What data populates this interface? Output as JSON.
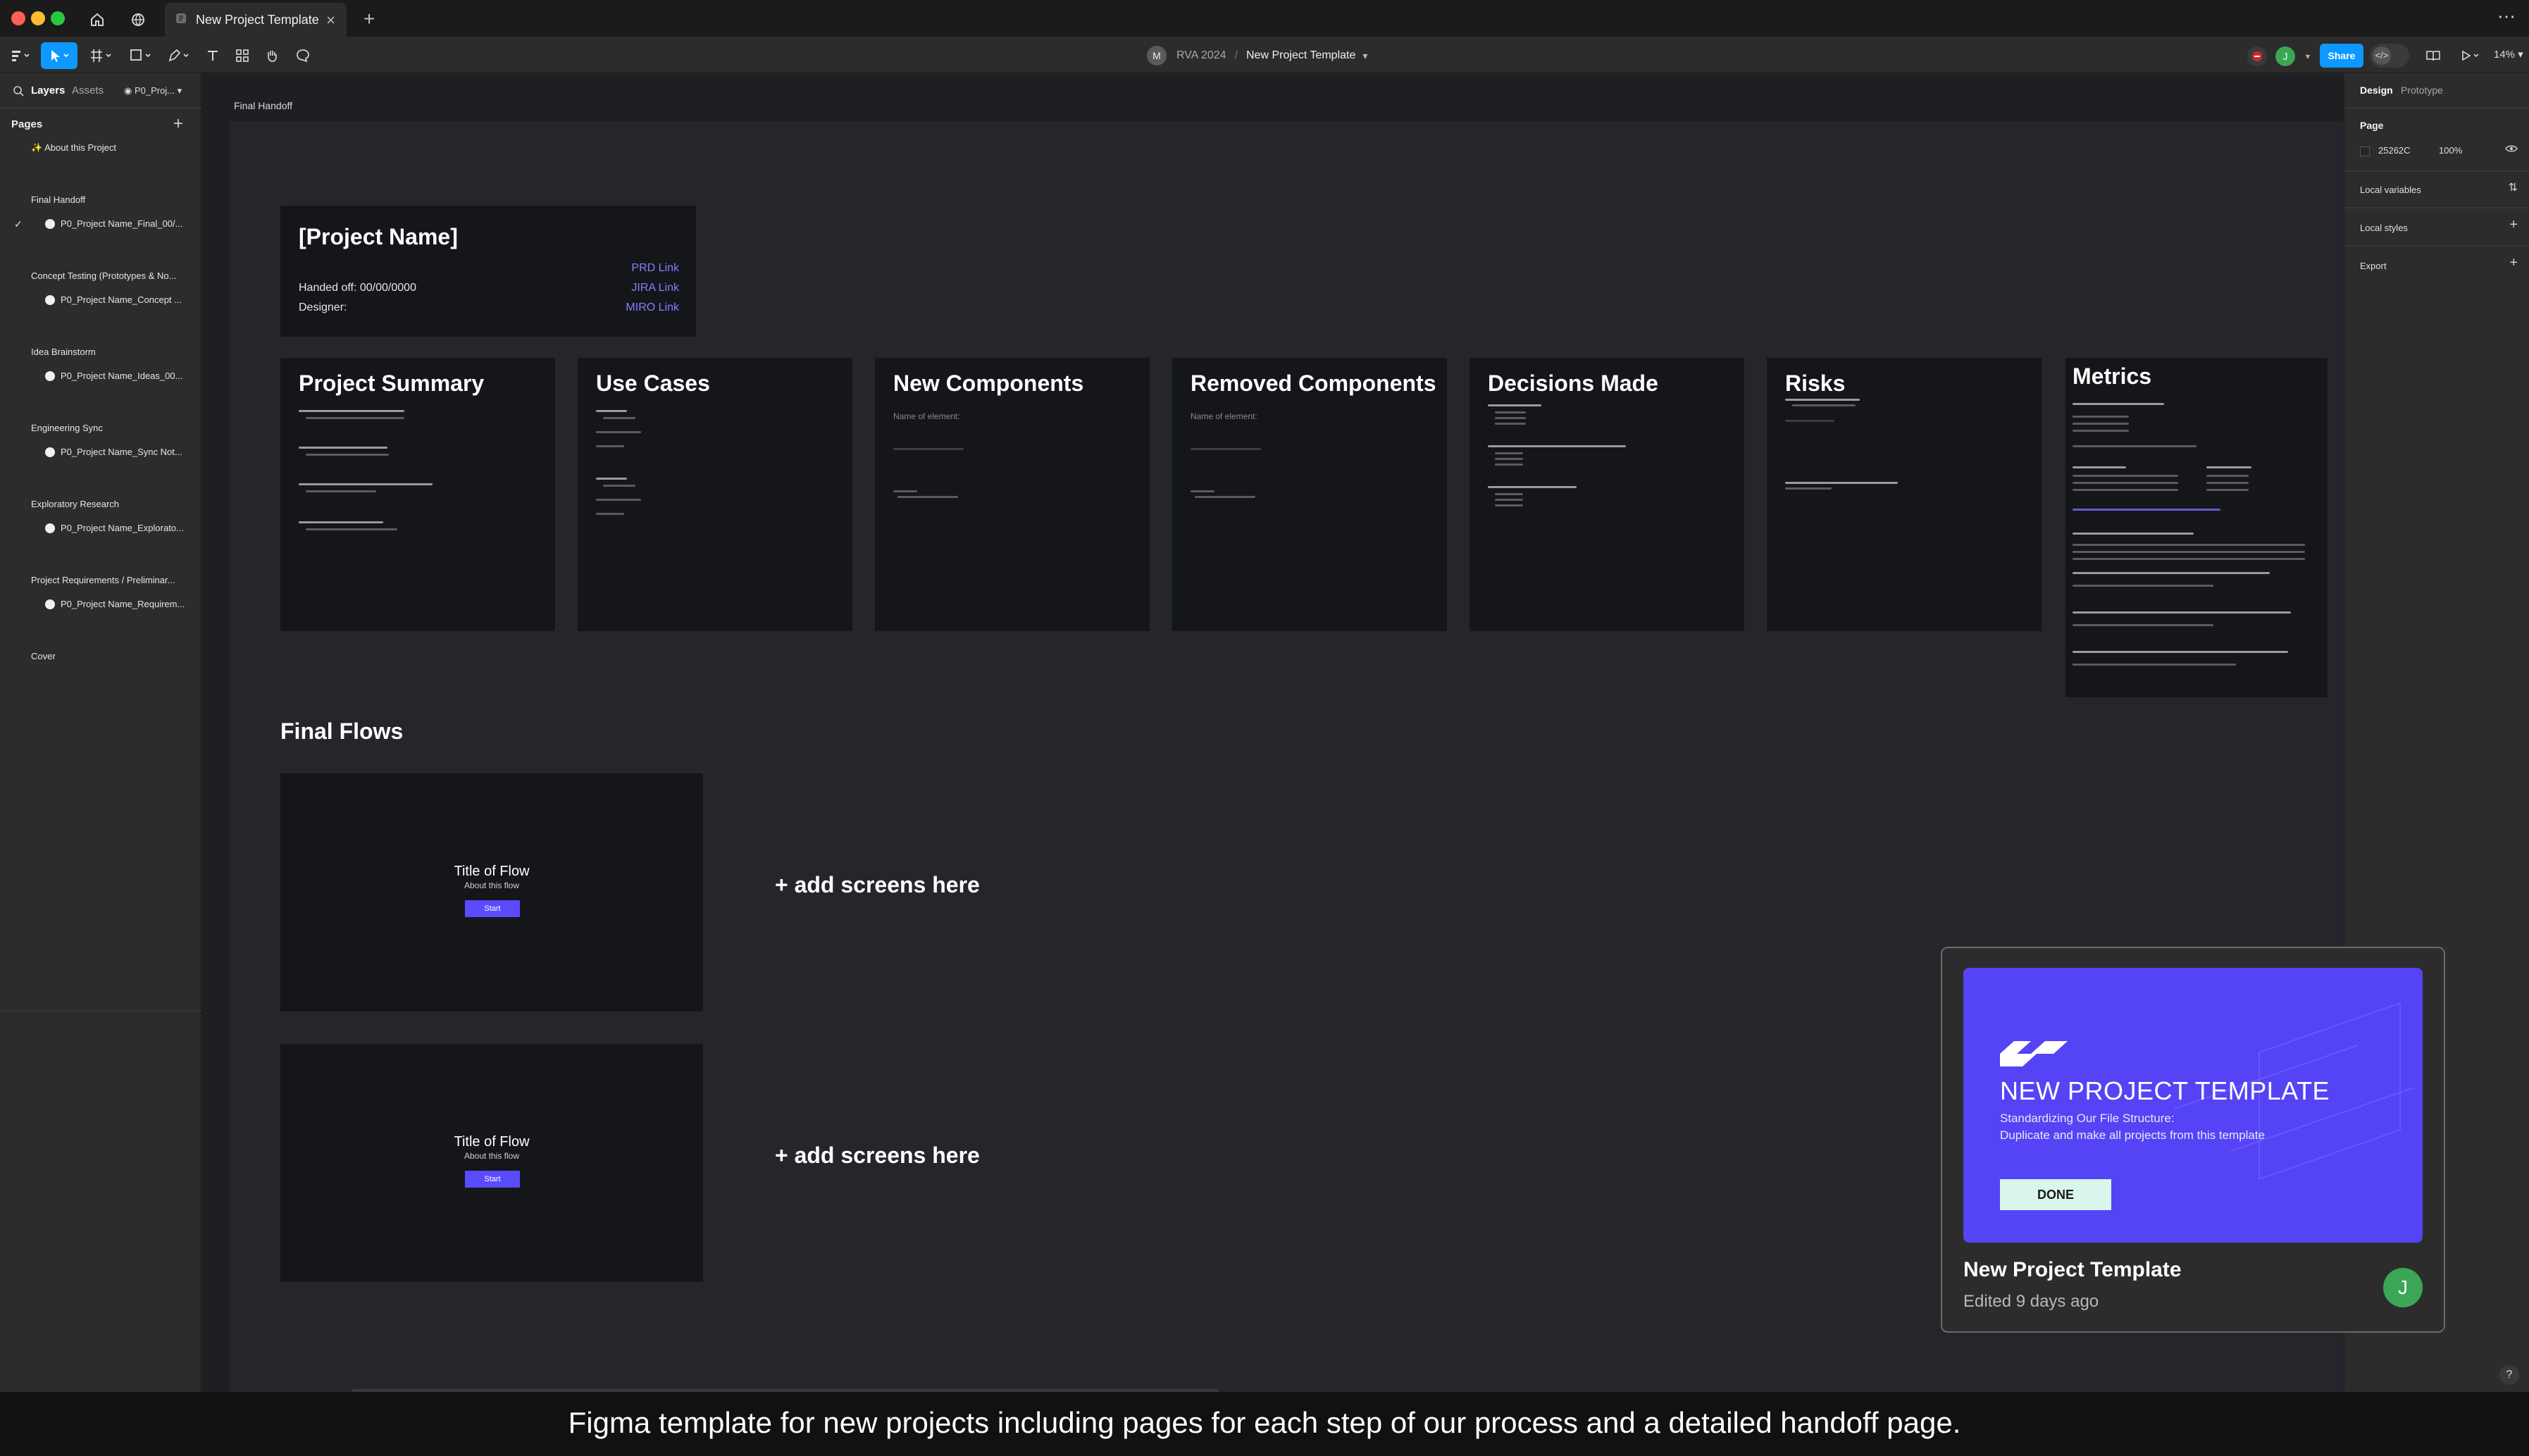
{
  "window": {
    "tab_title": "New Project Template",
    "tab_close": "×",
    "new_tab": "+",
    "more": "⋯"
  },
  "toolbar": {
    "team_initial": "M",
    "team_name": "RVA 2024",
    "separator": "/",
    "file_name": "New Project Template",
    "avatar_initial": "J",
    "share_label": "Share",
    "zoom_level": "14%"
  },
  "left_panel": {
    "tabs": [
      "Layers",
      "Assets"
    ],
    "page_selector": "P0_Proj...",
    "pages_heading": "Pages",
    "pages": [
      {
        "label": "✨ About this Project",
        "indented": false,
        "current": false
      },
      {
        "label": "Final Handoff",
        "indented": false,
        "current": false
      },
      {
        "label": "P0_Project Name_Final_00/...",
        "indented": true,
        "current": true
      },
      {
        "label": "Concept Testing (Prototypes & No...",
        "indented": false,
        "current": false
      },
      {
        "label": "P0_Project Name_Concept ...",
        "indented": true,
        "current": false
      },
      {
        "label": "Idea Brainstorm",
        "indented": false,
        "current": false
      },
      {
        "label": "P0_Project Name_Ideas_00...",
        "indented": true,
        "current": false
      },
      {
        "label": "Engineering Sync",
        "indented": false,
        "current": false
      },
      {
        "label": "P0_Project Name_Sync Not...",
        "indented": true,
        "current": false
      },
      {
        "label": "Exploratory Research",
        "indented": false,
        "current": false
      },
      {
        "label": "P0_Project Name_Explorato...",
        "indented": true,
        "current": false
      },
      {
        "label": "Project Requirements / Preliminar...",
        "indented": false,
        "current": false
      },
      {
        "label": "P0_Project Name_Requirem...",
        "indented": true,
        "current": false
      },
      {
        "label": "Cover",
        "indented": false,
        "current": false
      }
    ]
  },
  "canvas": {
    "frame_label": "Final Handoff",
    "handoff": {
      "title": "[Project Name]",
      "handed_off": "Handed off: 00/00/0000",
      "designer": "Designer:",
      "links": [
        "PRD Link",
        "JIRA Link",
        "MIRO Link"
      ]
    },
    "sections": [
      {
        "title": "Project Summary"
      },
      {
        "title": "Use Cases"
      },
      {
        "title": "New Components",
        "field": "Name of element:"
      },
      {
        "title": "Removed Components",
        "field": "Name of element:"
      },
      {
        "title": "Decisions Made"
      },
      {
        "title": "Risks"
      }
    ],
    "metrics_title": "Metrics",
    "final_flows_title": "Final Flows",
    "flows": [
      {
        "title": "Title of Flow",
        "subtitle": "About this flow",
        "button": "Start",
        "add": "+ add screens here"
      },
      {
        "title": "Title of Flow",
        "subtitle": "About this flow",
        "button": "Start",
        "add": "+ add screens here"
      }
    ]
  },
  "right_panel": {
    "tabs": [
      "Design",
      "Prototype"
    ],
    "page_heading": "Page",
    "bg_hex": "25262C",
    "bg_opacity": "100%",
    "local_variables": "Local variables",
    "local_styles": "Local styles",
    "export": "Export",
    "help": "?"
  },
  "preview_popup": {
    "thumb_title": "NEW PROJECT TEMPLATE",
    "thumb_sub1": "Standardizing Our File Structure:",
    "thumb_sub2": "Duplicate and make all projects from this template",
    "done_label": "DONE",
    "file_name": "New Project Template",
    "edited": "Edited 9 days ago",
    "avatar_initial": "J"
  },
  "caption": "Figma template for new projects including pages for each step of our process and a detailed handoff page.",
  "colors": {
    "accent_blue": "#0d99ff",
    "brand_purple": "#5544f5",
    "link_purple": "#8a7dff",
    "avatar_green": "#3aa757"
  }
}
